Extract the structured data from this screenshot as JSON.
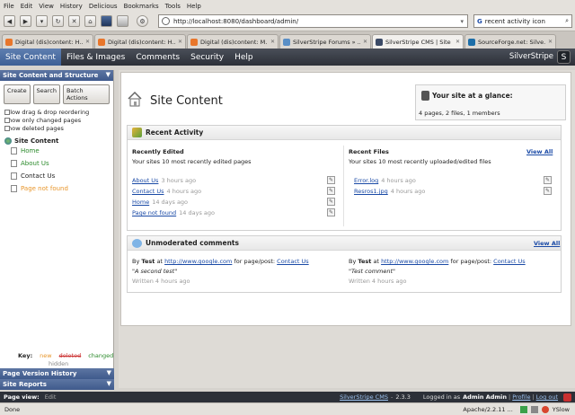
{
  "browser": {
    "menu": [
      "File",
      "Edit",
      "View",
      "History",
      "Delicious",
      "Bookmarks",
      "Tools",
      "Help"
    ],
    "url": "http://localhost:8080/dashboard/admin/",
    "search_value": "recent activity icon",
    "tabs": [
      {
        "label": "Digital (dis)content: H...",
        "icon_color": "#e8762b"
      },
      {
        "label": "Digital (dis)content: H...",
        "icon_color": "#e8762b"
      },
      {
        "label": "Digital (dis)content: M...",
        "icon_color": "#e8762b"
      },
      {
        "label": "SilverStripe Forums » ...",
        "icon_color": "#5a8fc6"
      },
      {
        "label": "SilverStripe CMS | Site ...",
        "icon_color": "#3b4a66",
        "active": true
      },
      {
        "label": "SourceForge.net: Silve...",
        "icon_color": "#1d6ea8"
      }
    ],
    "status": "Done",
    "status_right": "Apache/2.2.11 ...",
    "yslow": "YSlow"
  },
  "cms": {
    "tabs": [
      "Site Content",
      "Files & Images",
      "Comments",
      "Security",
      "Help"
    ],
    "brand": "SilverStripe",
    "accent": "#3c5f96"
  },
  "left": {
    "title": "Site Content and Structure",
    "buttons": [
      "Create",
      "Search",
      "Batch Actions"
    ],
    "checkboxes": [
      "Allow drag & drop reordering",
      "Show only changed pages",
      "Show deleted pages"
    ],
    "root": "Site Content",
    "tree": [
      {
        "label": "Home",
        "color": "#2b8a2b"
      },
      {
        "label": "About Us",
        "color": "#2b8a2b"
      },
      {
        "label": "Contact Us",
        "color": "#222222"
      },
      {
        "label": "Page not found",
        "color": "#e8962b"
      }
    ],
    "legend": {
      "key": "Key:",
      "new": "new",
      "deleted": "deleted",
      "changed": "changed",
      "hidden": "hidden"
    },
    "page_version_history": "Page Version History",
    "site_reports": "Site Reports"
  },
  "main": {
    "title": "Site Content",
    "glance": {
      "title": "Your site at a glance:",
      "summary": "4 pages, 2 files, 1 members"
    },
    "recent_activity": {
      "title": "Recent Activity",
      "edited_title": "Recently Edited",
      "edited_sub": "Your sites 10 most recently edited pages",
      "edited": [
        {
          "page": "About Us",
          "time": "3 hours ago"
        },
        {
          "page": "Contact Us",
          "time": "4 hours ago"
        },
        {
          "page": "Home",
          "time": "14 days ago"
        },
        {
          "page": "Page not found",
          "time": "14 days ago"
        }
      ],
      "files_title": "Recent Files",
      "view_all": "View All",
      "files_sub": "Your sites 10 most recently uploaded/edited files",
      "files": [
        {
          "name": "Error.log",
          "time": "4 hours ago"
        },
        {
          "name": "Resros1.jpg",
          "time": "4 hours ago"
        }
      ]
    },
    "comments": {
      "title": "Unmoderated comments",
      "view_all": "View All",
      "items": [
        {
          "by": "By",
          "author": "Test",
          "at": "at",
          "url": "http://www.google.com",
          "for": "for page/post:",
          "page": "Contact Us",
          "text": "\"A second test\"",
          "time": "Written 4 hours ago"
        },
        {
          "by": "By",
          "author": "Test",
          "at": "at",
          "url": "http://www.google.com",
          "for": "for page/post:",
          "page": "Contact Us",
          "text": "\"Test comment\"",
          "time": "Written 4 hours ago"
        }
      ]
    }
  },
  "footer": {
    "page_view": "Page view:",
    "edit": "Edit",
    "product": "SilverStripe CMS",
    "version": "2.3.3",
    "logged_in": "Logged in as",
    "user": "Admin Admin",
    "profile": "Profile",
    "logout": "Log out"
  }
}
